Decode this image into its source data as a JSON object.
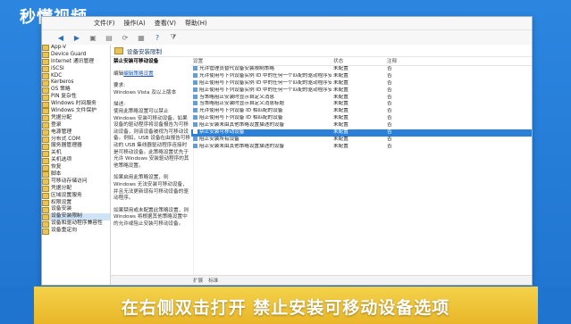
{
  "brand": {
    "logo_text": "秒懂视频"
  },
  "window": {
    "menu": [
      "文件(F)",
      "操作(A)",
      "查看(V)",
      "帮助(H)"
    ],
    "toolbar_icons": [
      "back-arrow-icon",
      "forward-arrow-icon",
      "up-folder-icon",
      "show-hide-icon",
      "refresh-icon",
      "export-icon",
      "help-icon",
      "filter-icon"
    ]
  },
  "tree": {
    "items": [
      "App-V",
      "Device Guard",
      "Internet 通讯管理",
      "iSCSI",
      "KDC",
      "Kerberos",
      "OS 策略",
      "PIN 复杂性",
      "Windows 时间服务",
      "Windows 文件保护",
      "凭据分配",
      "登录",
      "电源管理",
      "分布式 COM",
      "服务器管理器",
      "关机",
      "关机选项",
      "恢复",
      "脚本",
      "可移动存储访问",
      "凭据分配",
      "区域设置服务",
      "权限设置",
      "设备安装",
      "设备安装限制",
      "设备和驱动程序兼容性",
      "设备重定向"
    ],
    "selected_index": 24
  },
  "pane": {
    "header": "设备安装限制",
    "description": {
      "title": "禁止安装可移动设备",
      "edit_link": "编辑策略设置",
      "req_label": "要求:",
      "req_value": "Windows Vista 及以上版本",
      "desc_label": "描述:",
      "p1": "使用此策略设置可以禁止 Windows 安装可移动设备。如果设备的驱动程序将设备报告为可移动设备，则该设备被视为可移动设备。例如，USB 设备在由报告可移动的 USB 集线器驱动程序连接时是可移动设备。此策略设置优先于允许 Windows 安装驱动程序的其他策略设置。",
      "p2": "如果启用此策略设置，则 Windows 无法安装可移动设备，并且无法更新现有可移动设备的驱动程序。",
      "p3": "如果禁用或未配置此策略设置，则 Windows 将根据其他策略设置中的允许或阻止安装可移动设备。"
    },
    "columns": {
      "setting": "设置",
      "state": "状态",
      "comment": "注释"
    },
    "rows": [
      {
        "setting": "允许管理员替代设备安装限制策略",
        "state": "未配置",
        "comment": "否"
      },
      {
        "setting": "允许使用与下列设备实例 ID 中的任何一个匹配的驱动程序安装设备",
        "state": "未配置",
        "comment": "否"
      },
      {
        "setting": "阻止使用与下列设备实例 ID 中的任何一个匹配的驱动程序安装设备",
        "state": "未配置",
        "comment": "否"
      },
      {
        "setting": "阻止使用与下列设备实例 ID 中的任何一个匹配的驱动程序安装设备",
        "state": "未配置",
        "comment": "否"
      },
      {
        "setting": "当策略阻止安装时显示自定义消息",
        "state": "未配置",
        "comment": "否"
      },
      {
        "setting": "当策略阻止安装时显示自定义消息标题",
        "state": "未配置",
        "comment": "否"
      },
      {
        "setting": "允许使用与下列设备 ID 相匹配的设备",
        "state": "未配置",
        "comment": "否"
      },
      {
        "setting": "阻止使用与下列设备 ID 相匹配的设备",
        "state": "未配置",
        "comment": "否"
      },
      {
        "setting": "阻止安装未由其他策略设置描述的设备",
        "state": "未配置",
        "comment": "否"
      },
      {
        "setting": "禁止安装可移动设备",
        "state": "未配置",
        "comment": "否"
      },
      {
        "setting": "阻止安装所有设备",
        "state": "未配置",
        "comment": "否"
      },
      {
        "setting": "阻止安装未由其他策略设置描述的设备",
        "state": "未配置",
        "comment": "否"
      }
    ],
    "selected_row": 9,
    "tabs": [
      "扩展",
      "标准"
    ]
  },
  "caption": "在右侧双击打开 禁止安装可移动设备选项"
}
